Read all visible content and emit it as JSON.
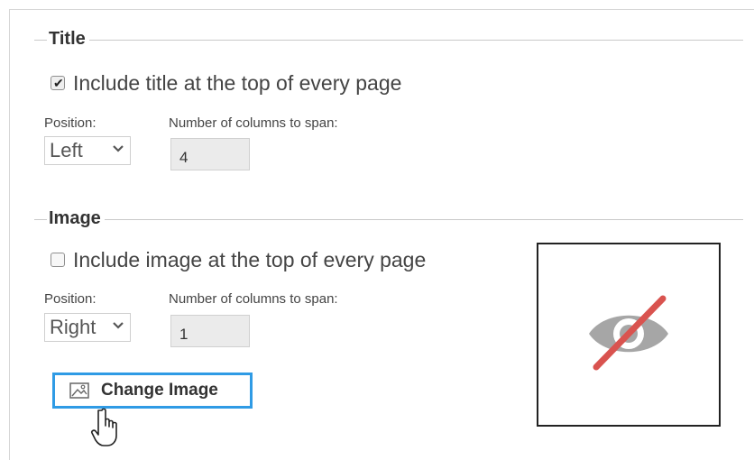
{
  "title_section": {
    "legend": "Title",
    "include_label": "Include title at the top of every page",
    "include_checked": true,
    "position_label": "Position:",
    "position_value": "Left",
    "columns_label": "Number of columns to span:",
    "columns_value": "4"
  },
  "image_section": {
    "legend": "Image",
    "include_label": "Include image at the top of every page",
    "include_checked": false,
    "position_label": "Position:",
    "position_value": "Right",
    "columns_label": "Number of columns to span:",
    "columns_value": "1",
    "change_button_label": "Change Image",
    "preview_icon": "eye-slash-icon"
  },
  "colors": {
    "button_border": "#2f9be5",
    "eye_gray": "#a6a6a6",
    "slash_red": "#d9534f"
  }
}
